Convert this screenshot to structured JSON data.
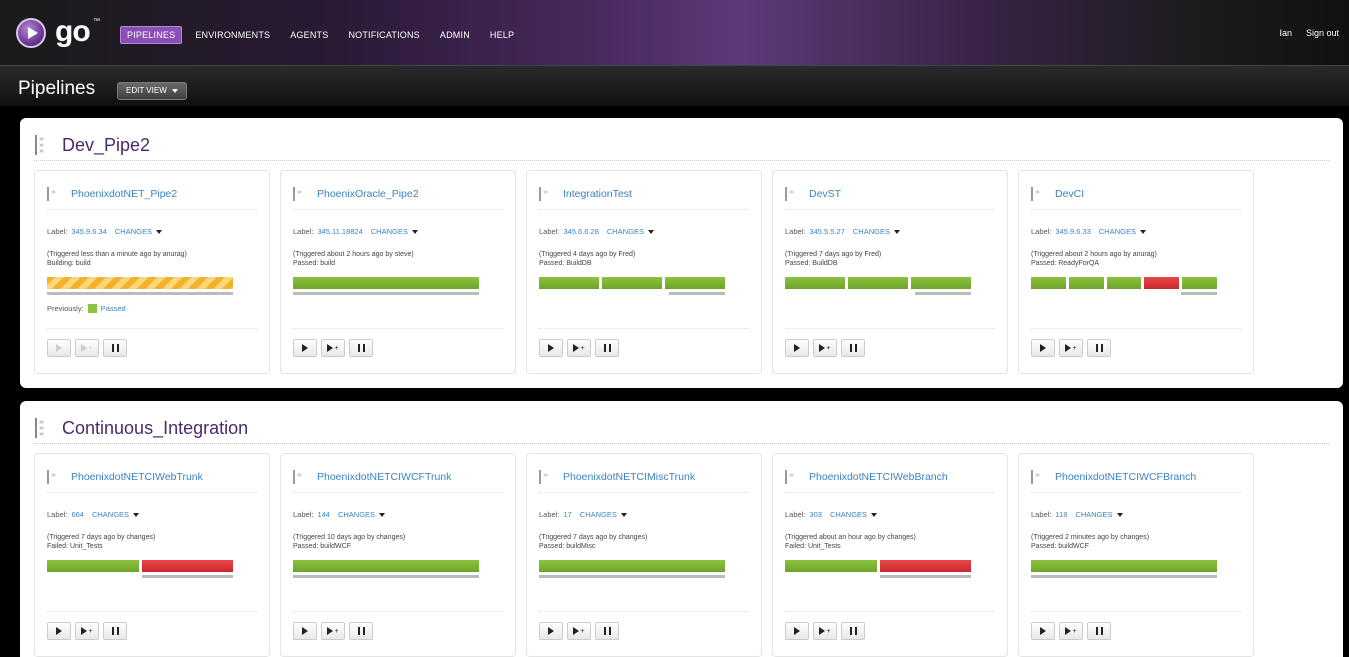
{
  "app": {
    "logo": "go",
    "tm": "™",
    "nav": [
      "PIPELINES",
      "ENVIRONMENTS",
      "AGENTS",
      "NOTIFICATIONS",
      "ADMIN",
      "HELP"
    ],
    "user": "Ian",
    "signout": "Sign out"
  },
  "header": {
    "title": "Pipelines",
    "edit_view": "EDIT VIEW"
  },
  "colors": {
    "passed": "#8dc23f",
    "failed": "#e8474a",
    "building": "#f2b32a",
    "accent": "#8a4fb5",
    "link": "#3b84c4"
  },
  "groups": [
    {
      "name": "Dev_Pipe2",
      "pipelines": [
        {
          "name": "PhoenixdotNET_Pipe2",
          "label_prefix": "Label:",
          "label": "345.9.6.34",
          "changes": "CHANGES",
          "trigger": "(Triggered less than a minute ago by anurag)",
          "status": "Building: build",
          "previously": "Previously:",
          "previous_status": "Passed"
        },
        {
          "name": "PhoenixOracle_Pipe2",
          "label_prefix": "Label:",
          "label": "345.11.18824",
          "changes": "CHANGES",
          "trigger": "(Triggered about 2 hours ago by steve)",
          "status": "Passed: build"
        },
        {
          "name": "IntegrationTest",
          "label_prefix": "Label:",
          "label": "345.6.6.28",
          "changes": "CHANGES",
          "trigger": "(Triggered 4 days ago by Fred)",
          "status": "Passed: BuildDB"
        },
        {
          "name": "DevST",
          "label_prefix": "Label:",
          "label": "345.5.5.27",
          "changes": "CHANGES",
          "trigger": "(Triggered 7 days ago by Fred)",
          "status": "Passed: BuildDB"
        },
        {
          "name": "DevCI",
          "label_prefix": "Label:",
          "label": "345.9.6.33",
          "changes": "CHANGES",
          "trigger": "(Triggered about 2 hours ago by anurag)",
          "status": "Passed: ReadyForQA"
        }
      ]
    },
    {
      "name": "Continuous_Integration",
      "pipelines": [
        {
          "name": "PhoenixdotNETCIWebTrunk",
          "label_prefix": "Label:",
          "label": "664",
          "changes": "CHANGES",
          "trigger": "(Triggered 7 days ago by changes)",
          "status": "Failed: Unit_Tests"
        },
        {
          "name": "PhoenixdotNETCIWCFTrunk",
          "label_prefix": "Label:",
          "label": "144",
          "changes": "CHANGES",
          "trigger": "(Triggered 10 days ago by changes)",
          "status": "Passed: buildWCF"
        },
        {
          "name": "PhoenixdotNETCIMiscTrunk",
          "label_prefix": "Label:",
          "label": "17",
          "changes": "CHANGES",
          "trigger": "(Triggered 7 days ago by changes)",
          "status": "Passed: buildMisc"
        },
        {
          "name": "PhoenixdotNETCIWebBranch",
          "label_prefix": "Label:",
          "label": "303",
          "changes": "CHANGES",
          "trigger": "(Triggered about an hour ago by changes)",
          "status": "Failed: Unit_Tests"
        },
        {
          "name": "PhoenixdotNETCIWCFBranch",
          "label_prefix": "Label:",
          "label": "118",
          "changes": "CHANGES",
          "trigger": "(Triggered 2 minutes ago by changes)",
          "status": "Passed: buildWCF"
        }
      ]
    }
  ]
}
